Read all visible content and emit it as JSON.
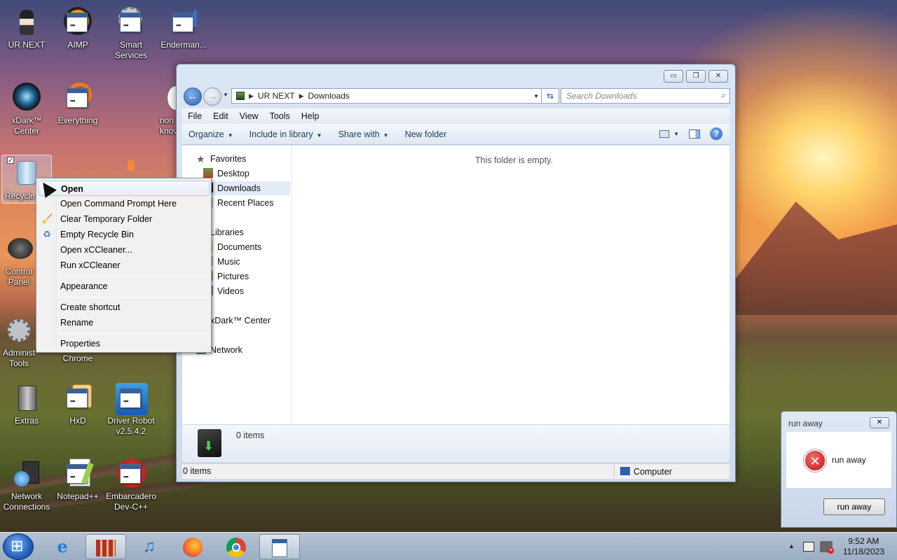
{
  "desktop": {
    "icons": [
      {
        "label": "UR NEXT"
      },
      {
        "label": "AIMP"
      },
      {
        "label": "Smart Services"
      },
      {
        "label": "Enderman..."
      },
      {
        "label": "xDark™ Center"
      },
      {
        "label": "Everything"
      },
      {
        "label": "non knov"
      },
      {
        "label": "Recycle"
      },
      {
        "label": "Control Panel"
      },
      {
        "label": "Administ Tools"
      },
      {
        "label": "Chrome"
      },
      {
        "label": "Extras"
      },
      {
        "label": "HxD"
      },
      {
        "label": "Driver Robot v2.5.4.2"
      },
      {
        "label": "Network Connections"
      },
      {
        "label": "Notepad++"
      },
      {
        "label": "Embarcadero Dev-C++"
      }
    ]
  },
  "explorer": {
    "breadcrumb": [
      "UR NEXT",
      "Downloads"
    ],
    "search_placeholder": "Search Downloads",
    "menu": [
      "File",
      "Edit",
      "View",
      "Tools",
      "Help"
    ],
    "toolbar": {
      "organize": "Organize",
      "include": "Include in library",
      "share": "Share with",
      "new_folder": "New folder"
    },
    "nav": {
      "favorites": "Favorites",
      "desktop": "Desktop",
      "downloads": "Downloads",
      "recent": "Recent Places",
      "libraries": "Libraries",
      "documents": "Documents",
      "music": "Music",
      "pictures": "Pictures",
      "videos": "Videos",
      "xdark": "xDark™ Center",
      "network": "Network"
    },
    "empty_message": "This folder is empty.",
    "details_count": "0 items",
    "status_left": "0 items",
    "status_right": "Computer"
  },
  "context_menu": {
    "open": "Open",
    "cmd": "Open Command Prompt Here",
    "clear_temp": "Clear Temporary Folder",
    "empty_bin": "Empty Recycle Bin",
    "open_xcc": "Open xCCleaner...",
    "run_xcc": "Run xCCleaner",
    "appearance": "Appearance",
    "create_shortcut": "Create shortcut",
    "rename": "Rename",
    "properties": "Properties"
  },
  "dialog": {
    "title": "run away",
    "message": "run away",
    "button": "run away"
  },
  "taskbar": {
    "time": "9:52 AM",
    "date": "11/18/2023"
  }
}
